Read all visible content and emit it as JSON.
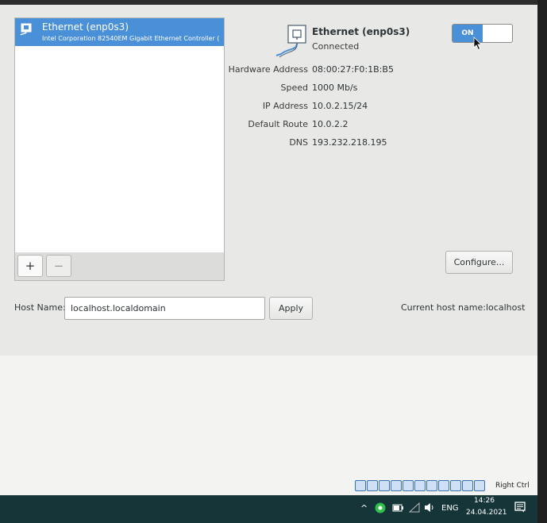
{
  "devices_list": [
    {
      "title": "Ethernet (enp0s3)",
      "subtitle": "Intel Corporation 82540EM Gigabit Ethernet Controller ("
    }
  ],
  "list_toolbar": {
    "add": "+",
    "remove": "−"
  },
  "device": {
    "name": "Ethernet (enp0s3)",
    "status": "Connected",
    "toggle_label": "ON",
    "details": [
      {
        "label": "Hardware Address",
        "value": "08:00:27:F0:1B:B5"
      },
      {
        "label": "Speed",
        "value": "1000 Mb/s"
      },
      {
        "label": "IP Address",
        "value": "10.0.2.15/24"
      },
      {
        "label": "Default Route",
        "value": "10.0.2.2"
      },
      {
        "label": "DNS",
        "value": "193.232.218.195"
      }
    ],
    "configure_label": "Configure..."
  },
  "hostname": {
    "label": "Host Name:",
    "value": "localhost.localdomain",
    "apply_label": "Apply",
    "current_label": "Current host name:",
    "current_value": "localhost"
  },
  "vm_bar": {
    "host_key": "Right Ctrl"
  },
  "taskbar": {
    "language": "ENG",
    "time": "14:26",
    "date": "24.04.2021"
  },
  "colors": {
    "accent": "#4a90d9",
    "taskbar": "#153538"
  }
}
